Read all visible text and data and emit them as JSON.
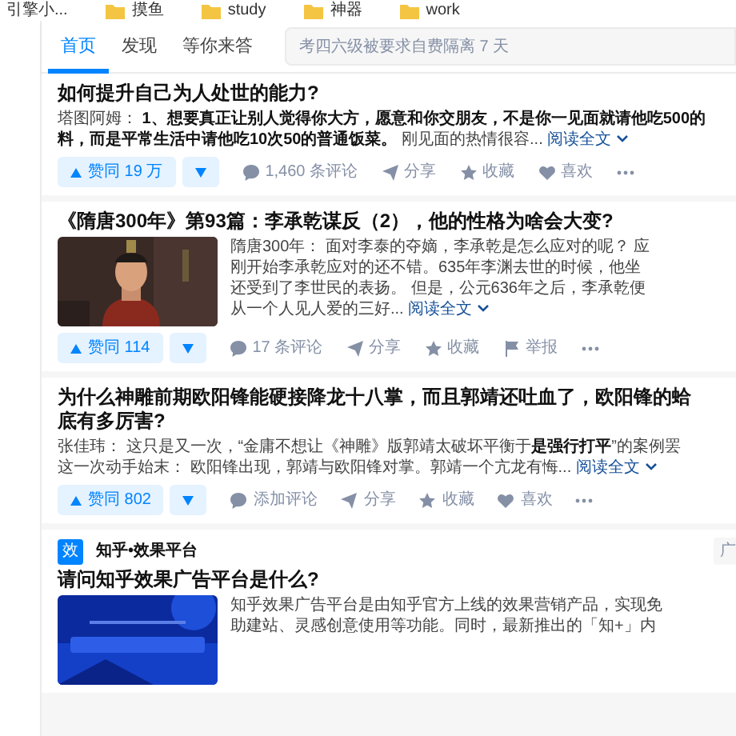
{
  "bookmarks": [
    {
      "kind": "page",
      "label": "引擎小..."
    },
    {
      "kind": "folder",
      "label": "摸鱼"
    },
    {
      "kind": "folder",
      "label": "study"
    },
    {
      "kind": "folder",
      "label": "神器"
    },
    {
      "kind": "folder",
      "label": "work"
    }
  ],
  "nav": {
    "tabs": [
      {
        "label": "首页",
        "selected": true
      },
      {
        "label": "发现",
        "selected": false
      },
      {
        "label": "等你来答",
        "selected": false
      }
    ],
    "search": {
      "placeholder": "考四六级被要求自费隔离 7 天"
    }
  },
  "feed": [
    {
      "kind": "answer",
      "title_lines": [
        "如何提升自己为人处世的能力?"
      ],
      "excerpt_lines": [
        "塔图阿姆： **1、想要真正让别人觉得你大方，愿意和你交朋友，不是你一见面就请他吃500的**",
        "**料，而是平常生活中请他吃10次50的普通饭菜。** 刚见面的热情很容..."
      ],
      "read_more": "阅读全文",
      "vote": "赞同 19 万",
      "actions": [
        {
          "kind": "comment",
          "label": "1,460 条评论"
        },
        {
          "kind": "share",
          "label": "分享"
        },
        {
          "kind": "star",
          "label": "收藏"
        },
        {
          "kind": "heart",
          "label": "喜欢"
        },
        {
          "kind": "more"
        }
      ]
    },
    {
      "kind": "answer",
      "title_lines": [
        "《隋唐300年》第93篇：李承乾谋反（2），他的性格为啥会大变?"
      ],
      "image": {
        "kind": "picture"
      },
      "excerpt_lines": [
        "隋唐300年： 面对李泰的夺嫡，李承乾是怎么应对的呢？ 应",
        "刚开始李承乾应对的还不错。635年李渊去世的时候，他坐",
        "还受到了李世民的表扬。 但是，公元636年之后，李承乾便",
        "从一个人见人爱的三好..."
      ],
      "read_more": "阅读全文",
      "vote": "赞同 114",
      "actions": [
        {
          "kind": "comment",
          "label": "17 条评论"
        },
        {
          "kind": "share",
          "label": "分享"
        },
        {
          "kind": "star",
          "label": "收藏"
        },
        {
          "kind": "flag",
          "label": "举报"
        },
        {
          "kind": "more"
        }
      ]
    },
    {
      "kind": "answer",
      "title_lines": [
        "为什么神雕前期欧阳锋能硬接降龙十八掌，而且郭靖还吐血了，欧阳锋的蛤",
        "底有多厉害?"
      ],
      "excerpt_lines": [
        "张佳玮： 这只是又一次，“金庸不想让《神雕》版郭靖太破坏平衡于**是强行打平**”的案例罢",
        "这一次动手始末： 欧阳锋出现，郭靖与欧阳锋对掌。郭靖一个亢龙有悔..."
      ],
      "read_more": "阅读全文",
      "vote": "赞同 802",
      "actions": [
        {
          "kind": "comment",
          "label": "添加评论"
        },
        {
          "kind": "share",
          "label": "分享"
        },
        {
          "kind": "star",
          "label": "收藏"
        },
        {
          "kind": "heart",
          "label": "喜欢"
        },
        {
          "kind": "more"
        }
      ]
    },
    {
      "kind": "ad",
      "brand_icon": "效",
      "brand": "知乎•效果平台",
      "tag": "广",
      "title_lines": [
        "请问知乎效果广告平台是什么?"
      ],
      "image": {
        "kind": "picture"
      },
      "excerpt_lines": [
        "知乎效果广告平台是由知乎官方上线的效果营销产品，实现免",
        "助建站、灵感创意使用等功能。同时，最新推出的「知+」内"
      ]
    }
  ]
}
